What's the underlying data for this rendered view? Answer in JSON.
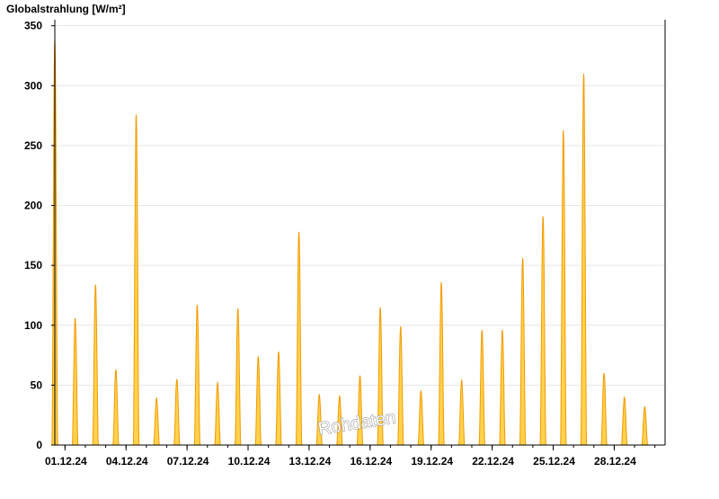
{
  "colors": {
    "fill": "#ffd24d",
    "stroke": "#f29a00",
    "grid": "#e6e6e6",
    "axis": "#000000"
  },
  "watermark": "Rohdaten",
  "chart_data": {
    "type": "area",
    "title": "Globalstrahlung [W/m²]",
    "xlabel": "",
    "ylabel": "",
    "ylim": [
      0,
      355
    ],
    "yticks": [
      0,
      50,
      100,
      150,
      200,
      250,
      300,
      350
    ],
    "xlim": [
      "2024-11-30T12:00",
      "2024-12-30T12:00"
    ],
    "xticks": [
      {
        "date": "2024-12-01",
        "label": "01.12.24"
      },
      {
        "date": "2024-12-04",
        "label": "04.12.24"
      },
      {
        "date": "2024-12-07",
        "label": "07.12.24"
      },
      {
        "date": "2024-12-10",
        "label": "10.12.24"
      },
      {
        "date": "2024-12-13",
        "label": "13.12.24"
      },
      {
        "date": "2024-12-16",
        "label": "16.12.24"
      },
      {
        "date": "2024-12-19",
        "label": "19.12.24"
      },
      {
        "date": "2024-12-22",
        "label": "22.12.24"
      },
      {
        "date": "2024-12-25",
        "label": "25.12.24"
      },
      {
        "date": "2024-12-28",
        "label": "28.12.24"
      }
    ],
    "grid": true,
    "series": [
      {
        "daily_peaks": [
          {
            "date": "2024-11-30",
            "peak": 339
          },
          {
            "date": "2024-12-01",
            "peak": 106
          },
          {
            "date": "2024-12-02",
            "peak": 134
          },
          {
            "date": "2024-12-03",
            "peak": 63
          },
          {
            "date": "2024-12-04",
            "peak": 276
          },
          {
            "date": "2024-12-05",
            "peak": 39
          },
          {
            "date": "2024-12-06",
            "peak": 55
          },
          {
            "date": "2024-12-07",
            "peak": 117
          },
          {
            "date": "2024-12-08",
            "peak": 52
          },
          {
            "date": "2024-12-09",
            "peak": 114
          },
          {
            "date": "2024-12-10",
            "peak": 74
          },
          {
            "date": "2024-12-11",
            "peak": 78
          },
          {
            "date": "2024-12-12",
            "peak": 178
          },
          {
            "date": "2024-12-13",
            "peak": 42
          },
          {
            "date": "2024-12-14",
            "peak": 41
          },
          {
            "date": "2024-12-15",
            "peak": 58
          },
          {
            "date": "2024-12-16",
            "peak": 115
          },
          {
            "date": "2024-12-17",
            "peak": 99
          },
          {
            "date": "2024-12-18",
            "peak": 45
          },
          {
            "date": "2024-12-19",
            "peak": 136
          },
          {
            "date": "2024-12-20",
            "peak": 54
          },
          {
            "date": "2024-12-21",
            "peak": 96
          },
          {
            "date": "2024-12-22",
            "peak": 96
          },
          {
            "date": "2024-12-23",
            "peak": 156
          },
          {
            "date": "2024-12-24",
            "peak": 191
          },
          {
            "date": "2024-12-25",
            "peak": 263
          },
          {
            "date": "2024-12-26",
            "peak": 310
          },
          {
            "date": "2024-12-27",
            "peak": 60
          },
          {
            "date": "2024-12-28",
            "peak": 40
          },
          {
            "date": "2024-12-29",
            "peak": 32
          }
        ]
      }
    ]
  }
}
